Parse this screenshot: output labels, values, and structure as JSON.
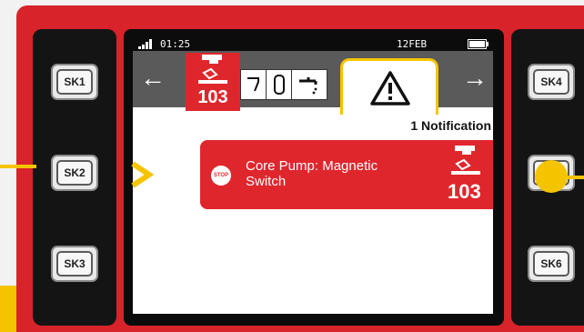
{
  "status_bar": {
    "time": "01:25",
    "date": "12FEB"
  },
  "tabs": {
    "back_glyph": "←",
    "forward_glyph": "→",
    "active_tab_icon": "warning-triangle-icon",
    "badge_code": "103"
  },
  "notifications": {
    "count_label": "1 Notification",
    "items": [
      {
        "title": "Core Pump: Magnetic Switch",
        "code": "103",
        "stop_label": "STOP"
      }
    ]
  },
  "softkeys": {
    "left": [
      "SK1",
      "SK2",
      "SK3"
    ],
    "right": [
      "SK4",
      "SK5",
      "SK6"
    ]
  },
  "colors": {
    "bezel": "#d8232a",
    "alarm": "#e0262d",
    "highlight": "#f5c400",
    "tab_bar": "#5a5a5a"
  }
}
